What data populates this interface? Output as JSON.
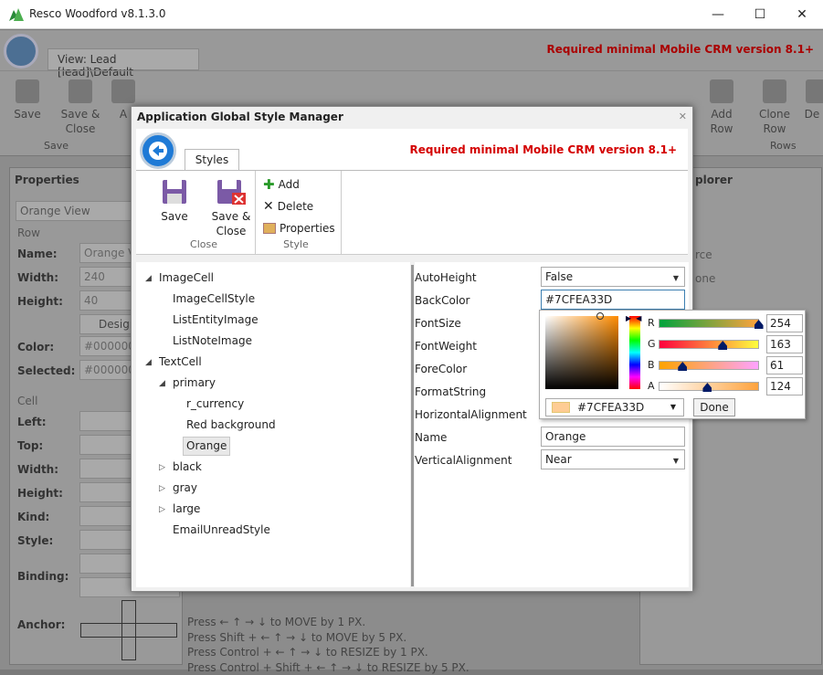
{
  "window": {
    "title": "Resco Woodford v8.1.3.0",
    "minimize": "—",
    "maximize": "☐",
    "close": "✕"
  },
  "bg": {
    "view_tab": "View: Lead [lead]\\Default",
    "required": "Required minimal Mobile CRM version 8.1+",
    "ribbon": {
      "save": "Save",
      "save_close": "Save & Close",
      "a_label": "A",
      "save_group": "Save",
      "add_row": "Add Row",
      "clone_row": "Clone Row",
      "de_label": "De R",
      "rows_group": "Rows"
    },
    "properties_title": "Properties",
    "explorer_title": "plorer",
    "orange_view": "Orange View",
    "row_label": "Row",
    "name_label": "Name:",
    "name_val": "Orange V",
    "width_label": "Width:",
    "width_val": "240",
    "height_label": "Height:",
    "height_val": "40",
    "design_btn": "Design",
    "color_label": "Color:",
    "color_val": "#000000",
    "selected_label": "Selected:",
    "selected_val": "#000000",
    "cell_label": "Cell",
    "left_label": "Left:",
    "top_label": "Top:",
    "width2_label": "Width:",
    "height2_label": "Height:",
    "kind_label": "Kind:",
    "style_label": "Style:",
    "binding_label": "Binding:",
    "anchor_label": "Anchor:",
    "rce": "rce",
    "one": "one",
    "hints": [
      "Press ← ↑ → ↓ to MOVE by 1 PX.",
      "Press Shift + ← ↑ → ↓ to MOVE by 5 PX.",
      "Press Control + ← ↑ → ↓ to RESIZE by 1 PX.",
      "Press Control + Shift + ← ↑ → ↓ to RESIZE by 5 PX."
    ]
  },
  "dialog": {
    "title": "Application Global Style Manager",
    "close": "✕",
    "tab": "Styles",
    "required": "Required minimal Mobile CRM version 8.1+",
    "save": "Save",
    "save_close_1": "Save &",
    "save_close_2": "Close",
    "close_group": "Close",
    "add": "Add",
    "delete": "Delete",
    "properties": "Properties",
    "style_group": "Style"
  },
  "tree": [
    {
      "label": "ImageCell",
      "level": 0,
      "arrow": "◢"
    },
    {
      "label": "ImageCellStyle",
      "level": 1,
      "arrow": ""
    },
    {
      "label": "ListEntityImage",
      "level": 1,
      "arrow": ""
    },
    {
      "label": "ListNoteImage",
      "level": 1,
      "arrow": ""
    },
    {
      "label": "TextCell",
      "level": 0,
      "arrow": "◢"
    },
    {
      "label": "primary",
      "level": 1,
      "arrow": "◢"
    },
    {
      "label": "r_currency",
      "level": 2,
      "arrow": ""
    },
    {
      "label": "Red background",
      "level": 2,
      "arrow": ""
    },
    {
      "label": "Orange",
      "level": 2,
      "arrow": "",
      "selected": true
    },
    {
      "label": "black",
      "level": 1,
      "arrow": "▷"
    },
    {
      "label": "gray",
      "level": 1,
      "arrow": "▷"
    },
    {
      "label": "large",
      "level": 1,
      "arrow": "▷"
    },
    {
      "label": "EmailUnreadStyle",
      "level": 1,
      "arrow": ""
    }
  ],
  "props": {
    "autoheight_label": "AutoHeight",
    "autoheight_val": "False",
    "backcolor_label": "BackColor",
    "backcolor_val": "#7CFEA33D",
    "fontsize_label": "FontSize",
    "fontweight_label": "FontWeight",
    "forecolor_label": "ForeColor",
    "formatstring_label": "FormatString",
    "halign_label": "HorizontalAlignment",
    "name_label": "Name",
    "name_val": "Orange",
    "valign_label": "VerticalAlignment",
    "valign_val": "Near"
  },
  "picker": {
    "r_label": "R",
    "r_val": "254",
    "r_frac": 0.996,
    "g_label": "G",
    "g_val": "163",
    "g_frac": 0.639,
    "b_label": "B",
    "b_val": "61",
    "b_frac": 0.239,
    "a_label": "A",
    "a_val": "124",
    "a_frac": 0.486,
    "hex": "#7CFEA33D",
    "done": "Done"
  }
}
